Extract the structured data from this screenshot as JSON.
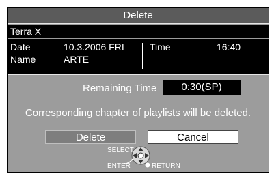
{
  "dialog": {
    "title": "Delete",
    "program_title": "Terra X",
    "info": {
      "date_label": "Date",
      "date_value": "10.3.2006 FRI",
      "name_label": "Name",
      "name_value": "ARTE",
      "time_label": "Time",
      "time_value": "16:40"
    },
    "remaining": {
      "label": "Remaining Time",
      "value": "0:30(SP)"
    },
    "message": "Corresponding chapter of playlists will be deleted.",
    "buttons": {
      "delete_label": "Delete",
      "cancel_label": "Cancel"
    },
    "hints": {
      "select": "SELECT",
      "enter": "ENTER",
      "return": "RETURN"
    }
  },
  "colors": {
    "dialog_bg": "#9c9c9c",
    "title_bg": "#5b5b5b",
    "info_bg": "#000000",
    "selected_button_bg": "#7e7e7e",
    "unselected_button_bg": "#ffffff"
  }
}
